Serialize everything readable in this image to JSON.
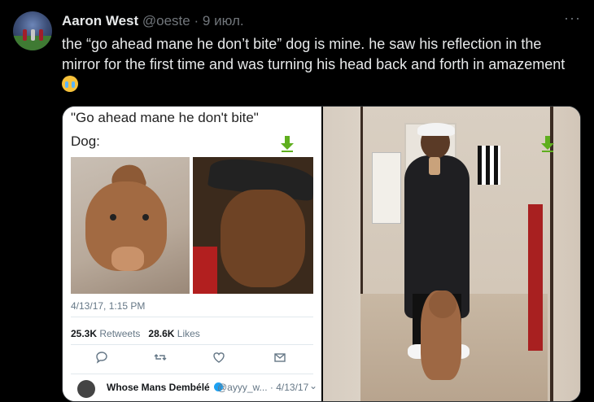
{
  "tweet": {
    "author_name": "Aaron West",
    "author_handle": "@oeste",
    "separator": "·",
    "date": "9 июл.",
    "more_label": "···",
    "text": "the “go ahead mane he don’t bite” dog is mine. he saw his reflection in the mirror for the first time and was turning his head back and forth in amazement",
    "emoji": "loudly-crying-face-emoji"
  },
  "embedded": {
    "line1": "\"Go ahead mane he don't bite\"",
    "line2": "Dog:",
    "timestamp": "4/13/17, 1:15 PM",
    "retweets_count": "25.3K",
    "retweets_label": "Retweets",
    "likes_count": "28.6K",
    "likes_label": "Likes",
    "reply": {
      "name": "Whose Mans Dembélé",
      "handle": "@ayyy_w...",
      "separator": "·",
      "date": "4/13/17"
    }
  },
  "icons": {
    "download": "download-icon",
    "reply": "reply-icon",
    "retweet": "retweet-icon",
    "like": "heart-icon",
    "message": "mail-icon",
    "verified": "verified-badge-icon"
  },
  "colors": {
    "background": "#000000",
    "text": "#e7e9ea",
    "muted": "#71767b",
    "download_green": "#5fae1e",
    "verified_blue": "#1da1f2"
  }
}
